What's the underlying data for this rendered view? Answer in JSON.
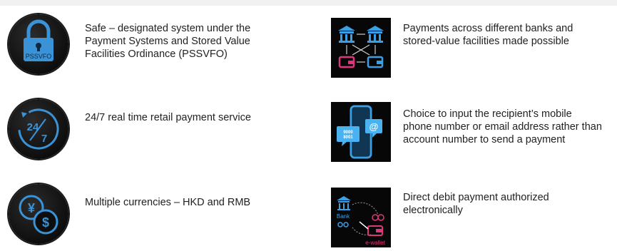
{
  "features": {
    "safe": {
      "icon": "padlock-icon",
      "icon_label": "PSSVFO",
      "lines": [
        "Safe – designated system under the",
        "Payment Systems and Stored Value",
        "Facilities Ordinance (PSSVFO)"
      ]
    },
    "realtime": {
      "icon": "clock-24-7-icon",
      "icon_label_top": "24",
      "icon_label_bottom": "7",
      "lines": [
        "24/7 real time retail payment service"
      ]
    },
    "currencies": {
      "icon": "yen-dollar-coins-icon",
      "lines": [
        "Multiple currencies – HKD and RMB"
      ]
    },
    "interbank": {
      "icon": "bank-wallet-network-icon",
      "lines": [
        "Payments across different banks and",
        "stored-value facilities made possible"
      ]
    },
    "proxy": {
      "icon": "phone-email-id-icon",
      "icon_label_code": [
        "9000",
        "8001"
      ],
      "lines": [
        "Choice to input the recipient’s mobile",
        "phone number or email address rather than",
        "account number to send a payment"
      ]
    },
    "directdebit": {
      "icon": "bank-to-ewallet-icon",
      "icon_label_bank": "Bank",
      "icon_label_wallet": "e-wallet",
      "lines": [
        "Direct debit payment authorized",
        "electronically"
      ]
    }
  },
  "colors": {
    "accent_blue": "#3aa0e6",
    "accent_pink": "#e0357a",
    "dark": "#0a0a0a"
  }
}
